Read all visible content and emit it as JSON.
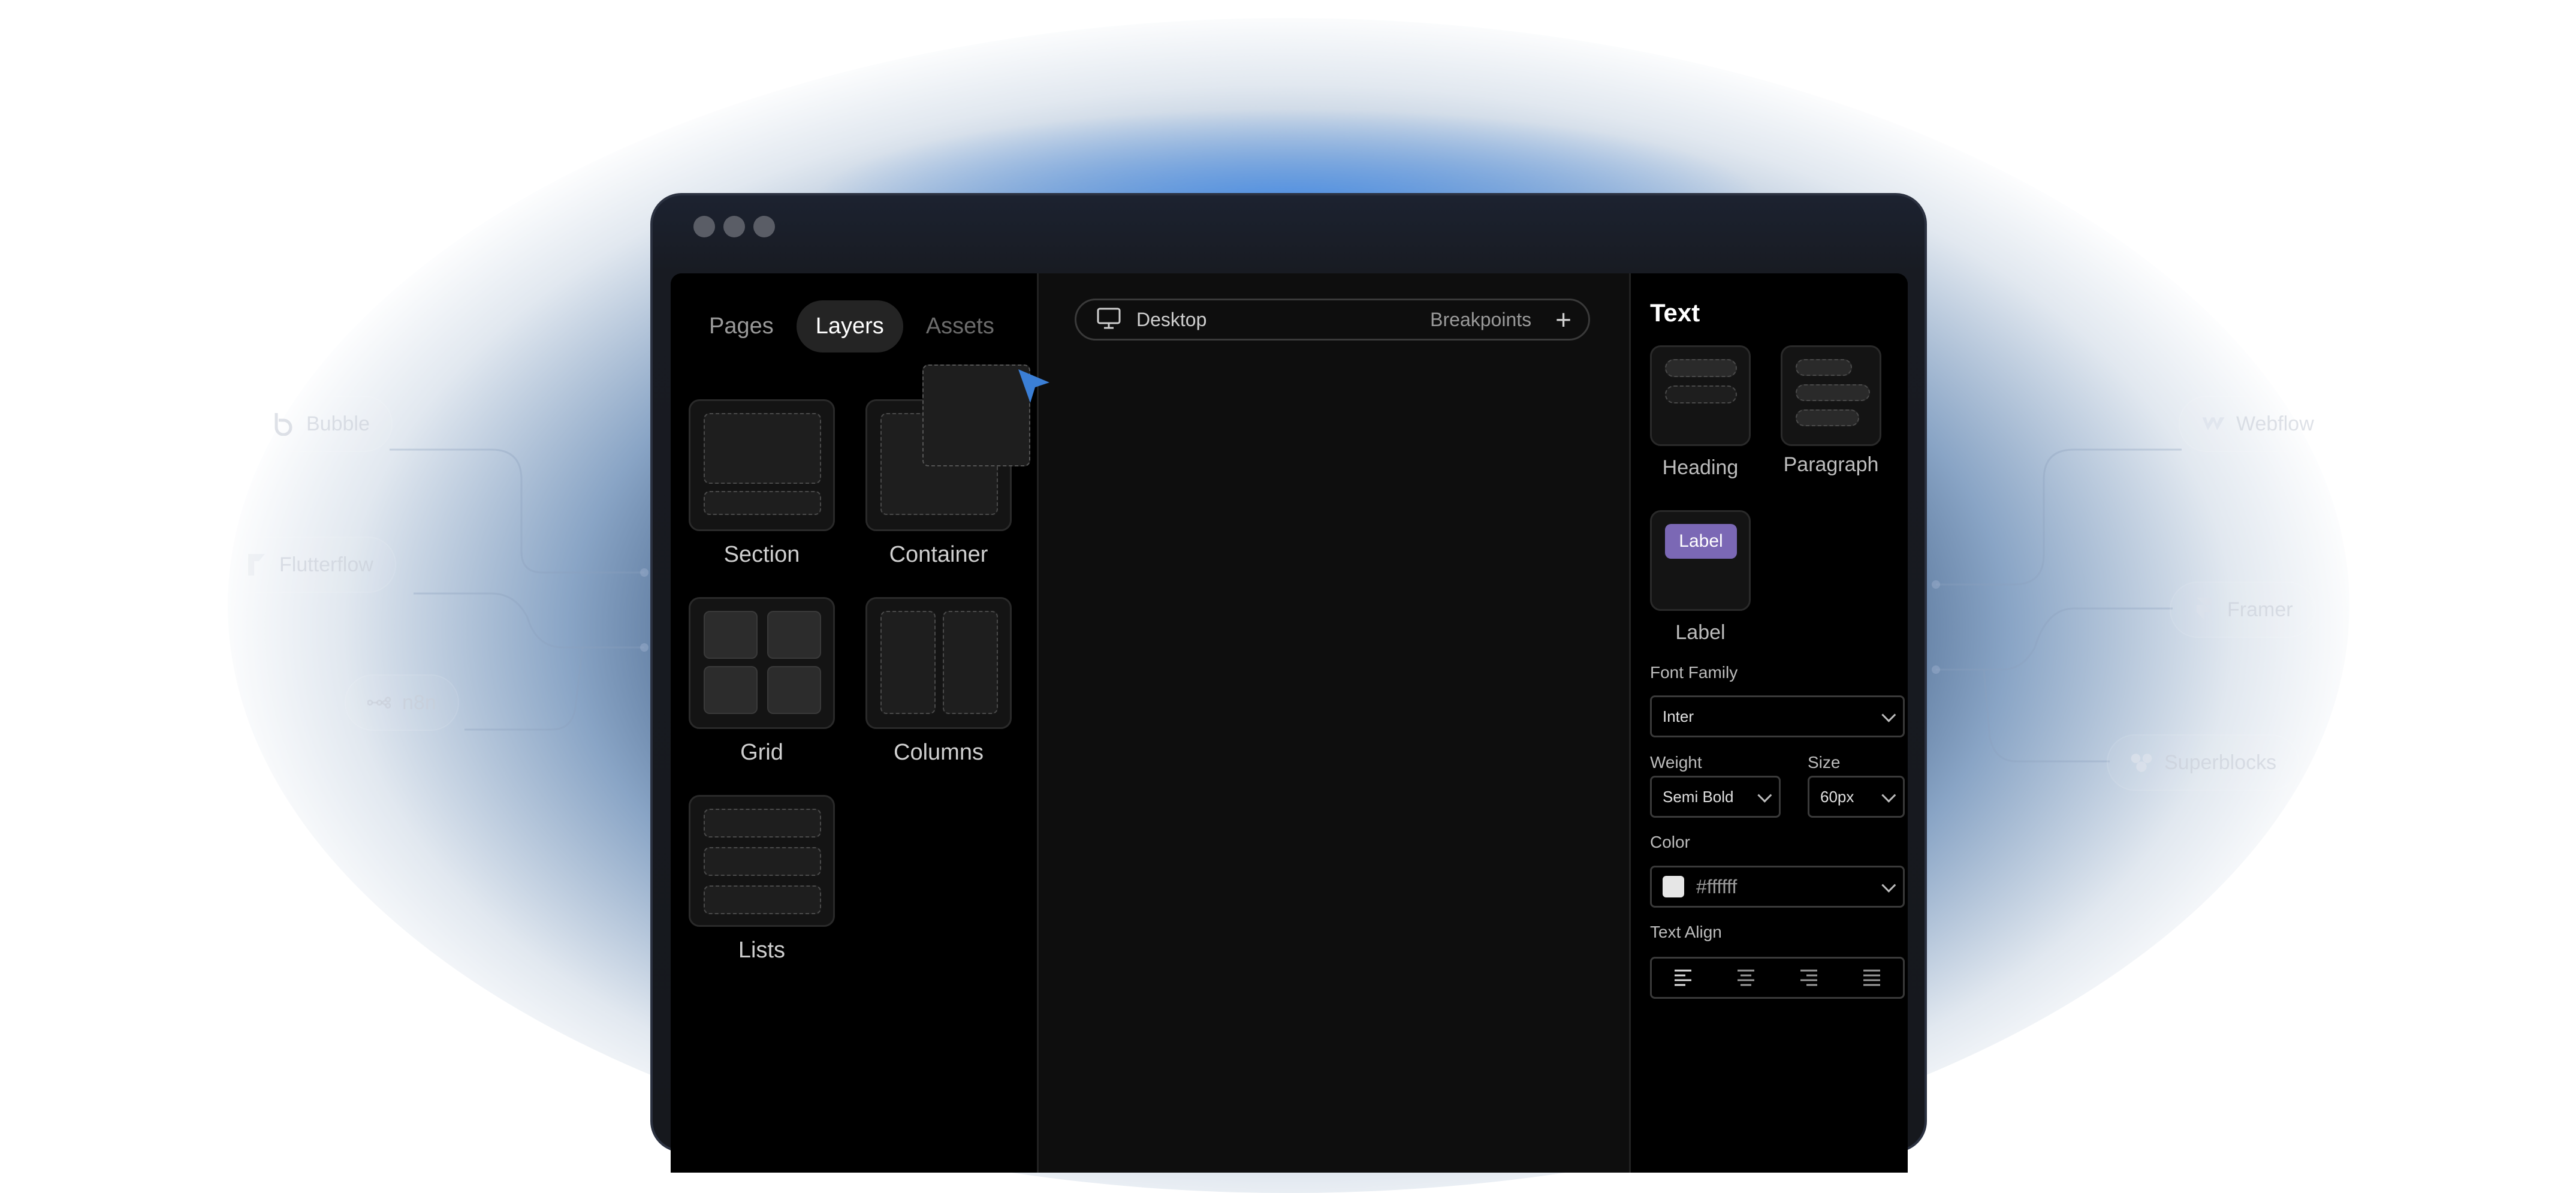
{
  "integrations": {
    "left": [
      {
        "name": "Bubble",
        "icon": "bubble-logo-icon"
      },
      {
        "name": "Flutterflow",
        "icon": "flutterflow-logo-icon"
      },
      {
        "name": "n8n",
        "icon": "n8n-logo-icon"
      }
    ],
    "right": [
      {
        "name": "Webflow",
        "icon": "webflow-logo-icon"
      },
      {
        "name": "Framer",
        "icon": "framer-logo-icon"
      },
      {
        "name": "Superblocks",
        "icon": "superblocks-logo-icon"
      }
    ]
  },
  "left_panel": {
    "tabs": [
      {
        "label": "Pages",
        "active": false
      },
      {
        "label": "Layers",
        "active": true
      },
      {
        "label": "Assets",
        "active": false
      }
    ],
    "components": [
      "Section",
      "Container",
      "Grid",
      "Columns",
      "Lists"
    ]
  },
  "canvas": {
    "device_label": "Desktop",
    "breakpoints_label": "Breakpoints",
    "add_label": "+"
  },
  "right_panel": {
    "title": "Text",
    "text_types": [
      "Heading",
      "Paragraph",
      "Label"
    ],
    "label_badge": "Label",
    "font_family_label": "Font Family",
    "font_family_value": "Inter",
    "weight_label": "Weight",
    "weight_value": "Semi Bold",
    "size_label": "Size",
    "size_value": "60px",
    "color_label": "Color",
    "color_value": "#ffffff",
    "text_align_label": "Text Align"
  },
  "colors": {
    "accent_cursor": "#3b7fd6",
    "label_badge": "#7b68b5",
    "panel_bg": "#000000",
    "canvas_bg": "#0e0e0e"
  }
}
